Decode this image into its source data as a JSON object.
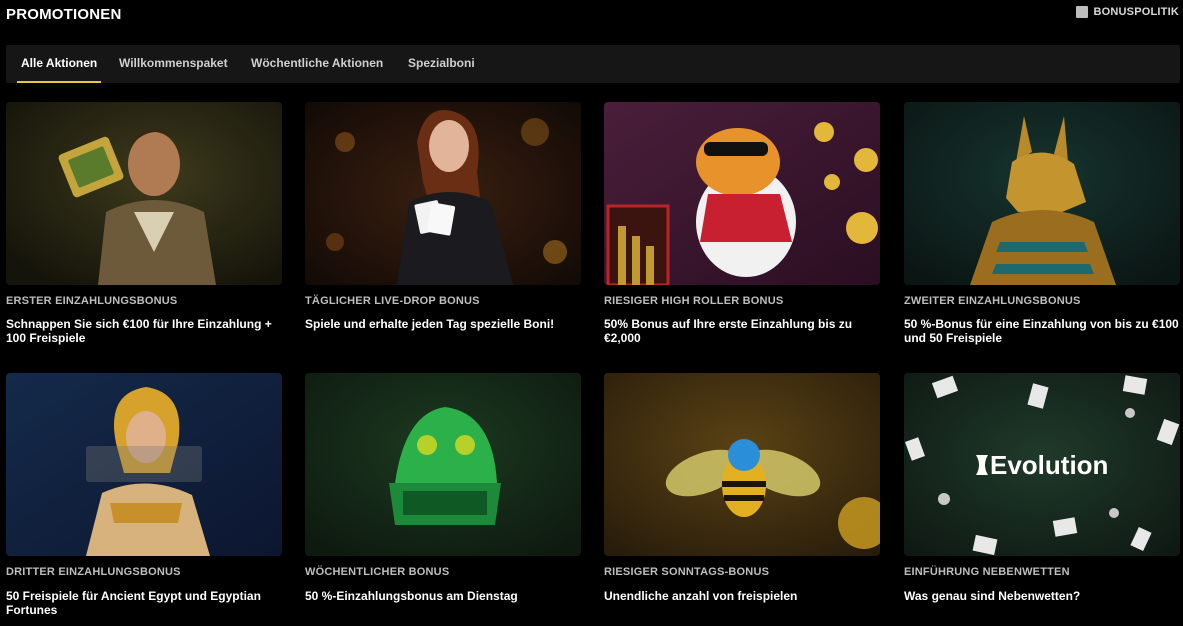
{
  "header": {
    "title": "PROMOTIONEN",
    "policy_label": "BONUSPOLITIK"
  },
  "tabs": [
    {
      "label": "Alle Aktionen",
      "active": true
    },
    {
      "label": "Willkommenspaket",
      "active": false
    },
    {
      "label": "Wöchentliche Aktionen",
      "active": false
    },
    {
      "label": "Spezialboni",
      "active": false
    }
  ],
  "promotions": [
    {
      "category": "ERSTER EINZAHLUNGSBONUS",
      "text": "Schnappen Sie sich €100 für Ihre Einzahlung + 100 Freispiele"
    },
    {
      "category": "TÄGLICHER LIVE-DROP BONUS",
      "text": "Spiele und erhalte jeden Tag spezielle Boni!"
    },
    {
      "category": "RIESIGER HIGH ROLLER BONUS",
      "text": "50% Bonus auf Ihre erste Einzahlung bis zu €2,000"
    },
    {
      "category": "ZWEITER EINZAHLUNGSBONUS",
      "text": "50 %-Bonus für eine Einzahlung von bis zu €100 und 50 Freispiele"
    },
    {
      "category": "DRITTER EINZAHLUNGSBONUS",
      "text": "50 Freispiele für Ancient Egypt und Egyptian Fortunes"
    },
    {
      "category": "WÖCHENTLICHER BONUS",
      "text": "50 %-Einzahlungsbonus am Dienstag"
    },
    {
      "category": "RIESIGER SONNTAGS-BONUS",
      "text": "Unendliche anzahl von freispielen"
    },
    {
      "category": "EINFÜHRUNG NEBENWETTEN",
      "text": "Was genau sind Nebenwetten?"
    }
  ],
  "evolution_logo_text": "Evolution",
  "colors": {
    "background": "#000000",
    "tabbar": "#161616",
    "active_tab_underline": "#e8c547"
  }
}
